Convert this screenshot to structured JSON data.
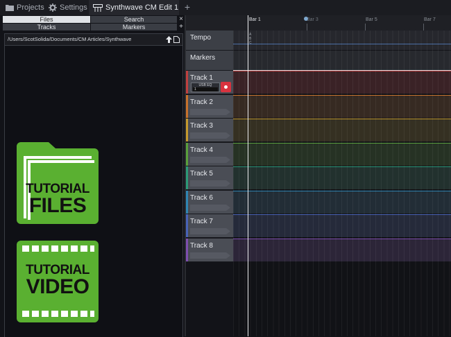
{
  "tabs": [
    {
      "label": "Projects",
      "icon": "folder-icon"
    },
    {
      "label": "Settings",
      "icon": "gear-icon"
    },
    {
      "label": "Synthwave CM Edit 1",
      "icon": "mixer-icon",
      "active": true
    }
  ],
  "add_tab_label": "+",
  "side_panel": {
    "files": "Files",
    "search": "Search",
    "tracks": "Tracks",
    "markers": "Markers",
    "close": "×",
    "add": "+"
  },
  "browser": {
    "path": "/Users/ScotSolida/Documents/CM Articles/Synthwave"
  },
  "badges": {
    "files": {
      "line1": "TUTORIAL",
      "line2": "FILES",
      "color": "#5ab031"
    },
    "video": {
      "line1": "TUTORIAL",
      "line2": "VIDEO",
      "color": "#5ab031"
    }
  },
  "ruler": {
    "bars": [
      "Bar 1",
      "Bar 3",
      "Bar 5",
      "Bar 7"
    ]
  },
  "tempo_lane": {
    "label": "Tempo",
    "letters": [
      "A",
      "B",
      "C"
    ]
  },
  "markers_lane": {
    "label": "Markers"
  },
  "plugin": {
    "label": "USB EQ",
    "value": "1"
  },
  "tracks": [
    {
      "name": "Track 1",
      "color": "#c0403f",
      "lane": "#3a2226"
    },
    {
      "name": "Track 2",
      "color": "#c8722c",
      "lane": "#362a22"
    },
    {
      "name": "Track 3",
      "color": "#c69a2e",
      "lane": "#353022"
    },
    {
      "name": "Track 4",
      "color": "#5aa03c",
      "lane": "#263224"
    },
    {
      "name": "Track 5",
      "color": "#2c9a78",
      "lane": "#22312e"
    },
    {
      "name": "Track 6",
      "color": "#2f86b4",
      "lane": "#222d36"
    },
    {
      "name": "Track 7",
      "color": "#4863b8",
      "lane": "#252a3a"
    },
    {
      "name": "Track 8",
      "color": "#7e4fb0",
      "lane": "#2c2538"
    }
  ]
}
